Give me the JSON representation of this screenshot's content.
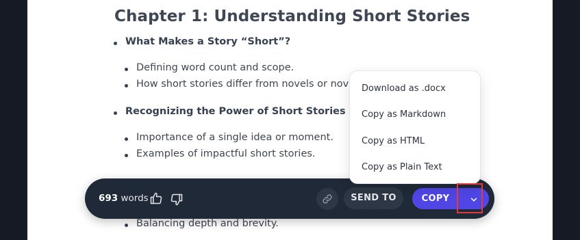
{
  "document": {
    "chapter_title": "Chapter 1: Understanding Short Stories",
    "sections": [
      {
        "heading": "What Makes a Story “Short”?",
        "items": [
          "Defining word count and scope.",
          "How short stories differ from novels or nove"
        ]
      },
      {
        "heading": "Recognizing the Power of Short Stories",
        "items": [
          "Importance of a single idea or moment.",
          "Examples of impactful short stories."
        ]
      }
    ],
    "partial_item": "Balancing depth and brevity."
  },
  "menu": {
    "items": [
      "Download as .docx",
      "Copy as Markdown",
      "Copy as HTML",
      "Copy as Plain Text"
    ]
  },
  "toolbar": {
    "word_count": "693",
    "word_label": "words",
    "send_to_label": "SEND TO",
    "copy_label": "COPY",
    "icons": [
      "thumbs-up-icon",
      "thumbs-down-icon",
      "link-icon",
      "chevron-down-icon"
    ]
  },
  "colors": {
    "page_background": "#161a24",
    "toolbar_background": "#1f2937",
    "copy_button": "#4f46e5",
    "highlight_border": "#e5393b",
    "heading_text": "#3f4754"
  }
}
